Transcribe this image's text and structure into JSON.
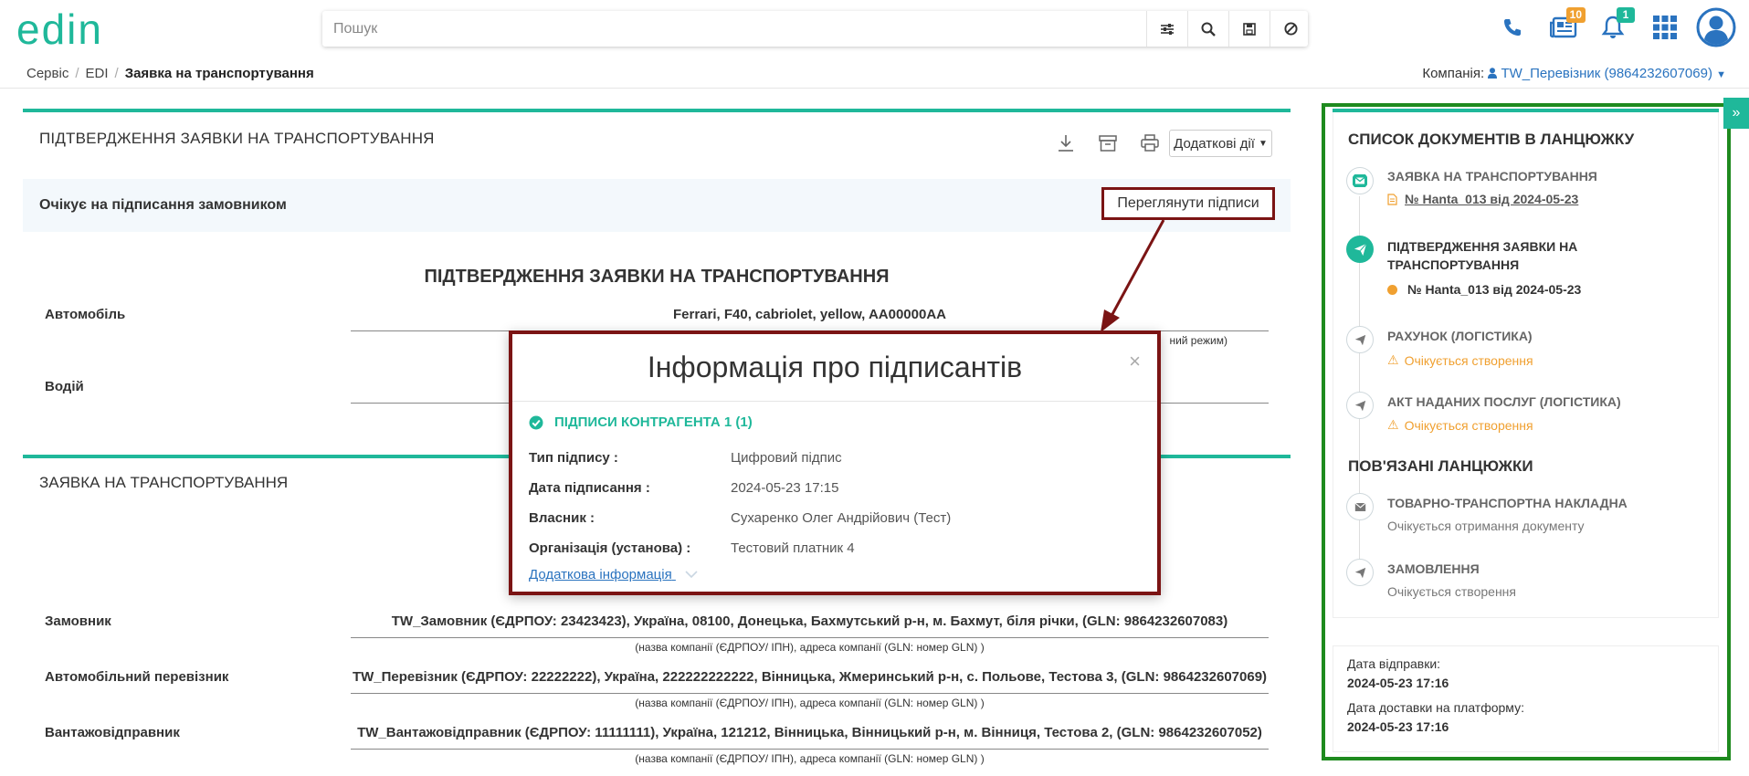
{
  "app": {
    "logo_text": "edin"
  },
  "search": {
    "placeholder": "Пошук"
  },
  "header": {
    "docs_badge": "10",
    "bell_badge": "1"
  },
  "breadcrumb": {
    "items": [
      "Сервіс",
      "EDI"
    ],
    "current": "Заявка на транспортування"
  },
  "company": {
    "label": "Компанія:",
    "value": "TW_Перевізник (9864232607069)"
  },
  "document": {
    "title": "ПІДТВЕРДЖЕННЯ ЗАЯВКИ НА ТРАНСПОРТУВАННЯ",
    "more_actions": "Додаткові дії",
    "status": "Очікує на підписання замовником",
    "view_signatures": "Переглянути підписи",
    "form_heading": "ПІДТВЕРДЖЕННЯ ЗАЯВКИ НА ТРАНСПОРТУВАННЯ",
    "car_label": "Автомобіль",
    "car_value": "Ferrari, F40, cabriolet, yellow, AA00000AA",
    "car_hint_tail": "ний режим)",
    "driver_label": "Водій"
  },
  "request": {
    "title": "ЗАЯВКА НА ТРАНСПОРТУВАННЯ",
    "rows": [
      {
        "label": "Замовник",
        "value": "TW_Замовник (ЄДРПОУ: 23423423), Україна, 08100, Донецька, Бахмутський р-н, м. Бахмут, біля річки, (GLN: 9864232607083)",
        "hint": "(назва компанії (ЄДРПОУ/ ІПН), адреса компанії (GLN: номер GLN) )"
      },
      {
        "label": "Автомобільний перевізник",
        "value": "TW_Перевізник (ЄДРПОУ: 22222222), Україна, 222222222222, Вінницька, Жмеринський р-н, с. Польове, Тестова 3, (GLN: 9864232607069)",
        "hint": "(назва компанії (ЄДРПОУ/ ІПН), адреса компанії (GLN: номер GLN) )"
      },
      {
        "label": "Вантажовідправник",
        "value": "TW_Вантажовідправник (ЄДРПОУ: 11111111), Україна, 121212, Вінницька, Вінницький р-н, м. Вінниця, Тестова 2, (GLN: 9864232607052)",
        "hint": "(назва компанії (ЄДРПОУ/ ІПН), адреса компанії (GLN: номер GLN) )"
      }
    ]
  },
  "modal": {
    "title": "Інформація про підписантів",
    "close": "×",
    "section": "ПІДПИСИ КОНТРАГЕНТА 1 (1)",
    "fields": [
      {
        "label": "Тип підпису :",
        "value": "Цифровий підпис"
      },
      {
        "label": "Дата підписання :",
        "value": "2024-05-23 17:15"
      },
      {
        "label": "Власник :",
        "value": "Сухаренко Олег Андрійович (Тест)"
      },
      {
        "label": "Організація (установа) :",
        "value": "Тестовий платник 4"
      }
    ],
    "more_info": "Додаткова інформація"
  },
  "chain": {
    "heading": "СПИСОК ДОКУМЕНТІВ В ЛАНЦЮЖКУ",
    "items": [
      {
        "title": "ЗАЯВКА НА ТРАНСПОРТУВАННЯ",
        "sub": "№ Hanta_013 від 2024-05-23"
      },
      {
        "title": "ПІДТВЕРДЖЕННЯ ЗАЯВКИ НА ТРАНСПОРТУВАННЯ",
        "sub": "№ Hanta_013 від 2024-05-23"
      },
      {
        "title": "РАХУНОК (ЛОГІСТИКА)",
        "sub": "Очікується створення"
      },
      {
        "title": "АКТ НАДАНИХ ПОСЛУГ (ЛОГІСТИКА)",
        "sub": "Очікується створення"
      }
    ],
    "related_heading": "ПОВ'ЯЗАНІ ЛАНЦЮЖКИ",
    "related": [
      {
        "title": "ТОВАРНО-ТРАНСПОРТНА НАКЛАДНА",
        "sub": "Очікується отримання документу"
      },
      {
        "title": "ЗАМОВЛЕННЯ",
        "sub": "Очікується створення"
      }
    ]
  },
  "delivery": {
    "sent_label": "Дата відправки:",
    "sent_value": "2024-05-23 17:16",
    "delivered_label": "Дата доставки на платформу:",
    "delivered_value": "2024-05-23 17:16"
  },
  "colors": {
    "accent": "#1fb89a",
    "link": "#2a73bf",
    "highlight_frame": "#7b1414",
    "panel_frame": "#1e8a1e",
    "warning": "#f0a030"
  }
}
